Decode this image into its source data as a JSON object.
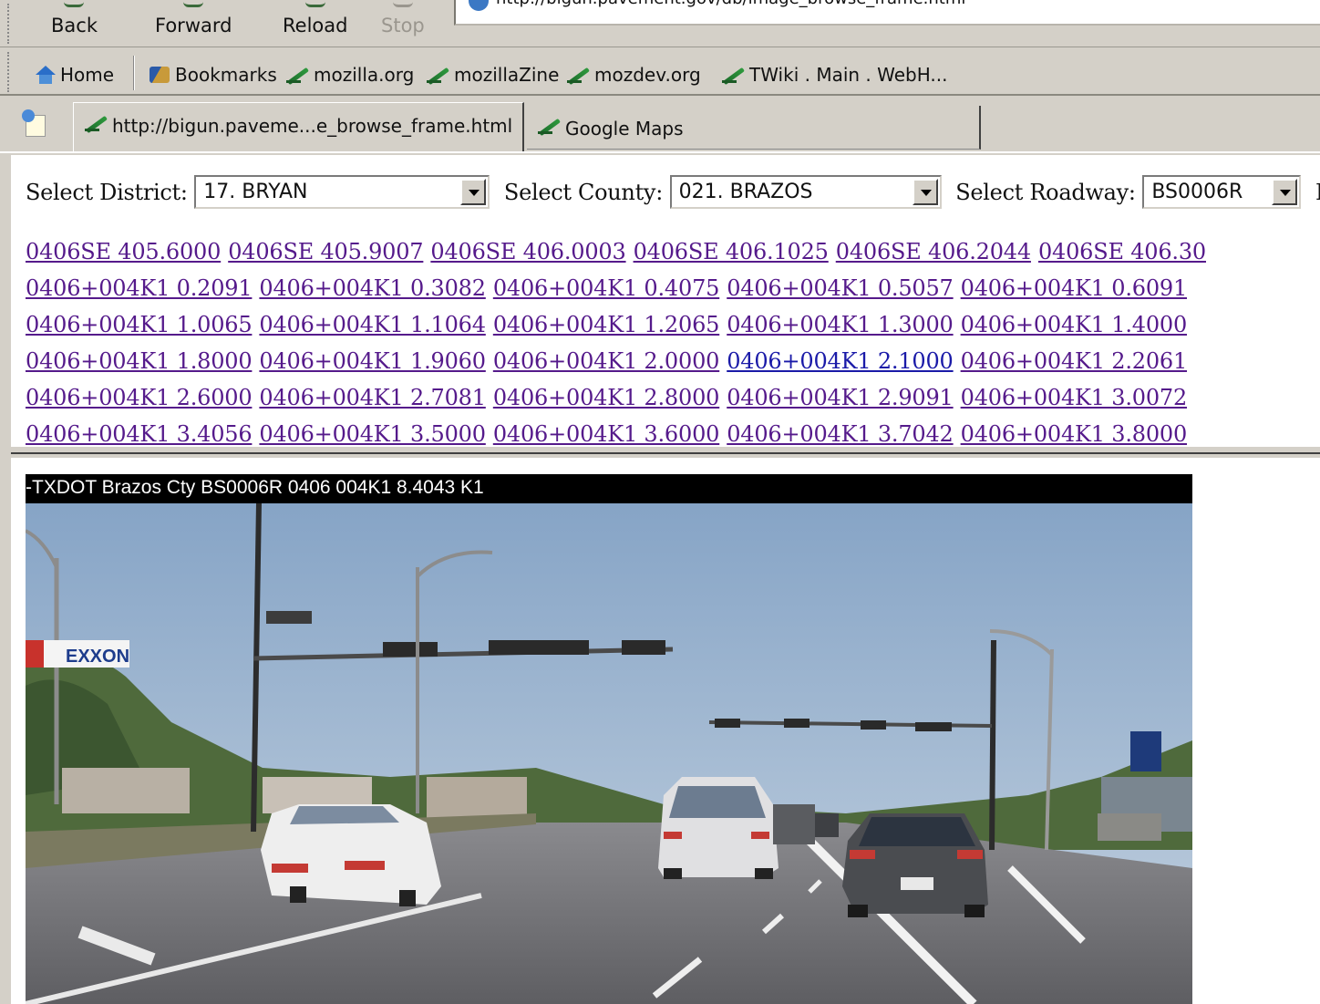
{
  "browser": {
    "nav_buttons": {
      "back": "Back",
      "forward": "Forward",
      "reload": "Reload",
      "stop": "Stop"
    },
    "url": "http://bigun.pavement.gov/db/image_browse_frame.html",
    "bookmarks": [
      "Home",
      "Bookmarks",
      "mozilla.org",
      "mozillaZine",
      "mozdev.org",
      "TWiki . Main . WebH..."
    ],
    "tabs": [
      {
        "label": "http://bigun.paveme...e_browse_frame.html",
        "active": true
      },
      {
        "label": "Google Maps",
        "active": false
      }
    ]
  },
  "selectors": {
    "district_label": "Select District:",
    "district_value": "17. BRYAN",
    "county_label": "Select County:",
    "county_value": "021. BRAZOS",
    "roadway_label": "Select Roadway:",
    "roadway_value": "BS0006R",
    "trailing_cut": "F"
  },
  "links": [
    [
      "0406SE 405.6000",
      "0406SE 405.9007",
      "0406SE 406.0003",
      "0406SE 406.1025",
      "0406SE 406.2044",
      "0406SE 406.30"
    ],
    [
      "0406+004K1 0.2091",
      "0406+004K1 0.3082",
      "0406+004K1 0.4075",
      "0406+004K1 0.5057",
      "0406+004K1 0.6091"
    ],
    [
      "0406+004K1 1.0065",
      "0406+004K1 1.1064",
      "0406+004K1 1.2065",
      "0406+004K1 1.3000",
      "0406+004K1 1.4000"
    ],
    [
      "0406+004K1 1.8000",
      "0406+004K1 1.9060",
      "0406+004K1 2.0000",
      "0406+004K1 2.1000",
      "0406+004K1 2.2061"
    ],
    [
      "0406+004K1 2.6000",
      "0406+004K1 2.7081",
      "0406+004K1 2.8000",
      "0406+004K1 2.9091",
      "0406+004K1 3.0072"
    ],
    [
      "0406+004K1 3.4056",
      "0406+004K1 3.5000",
      "0406+004K1 3.6000",
      "0406+004K1 3.7042",
      "0406+004K1 3.8000"
    ]
  ],
  "image": {
    "caption": "-TXDOT   Brazos Cty   BS0006R  0406 004K1   8.4043 K1",
    "gas_sign": "EXXON"
  },
  "colors": {
    "chrome": "#d4d0c8",
    "link_visited": "#551a8b",
    "link_current": "#1a1aa8",
    "sky": "#9ab4d4",
    "road": "#6c6c70"
  }
}
